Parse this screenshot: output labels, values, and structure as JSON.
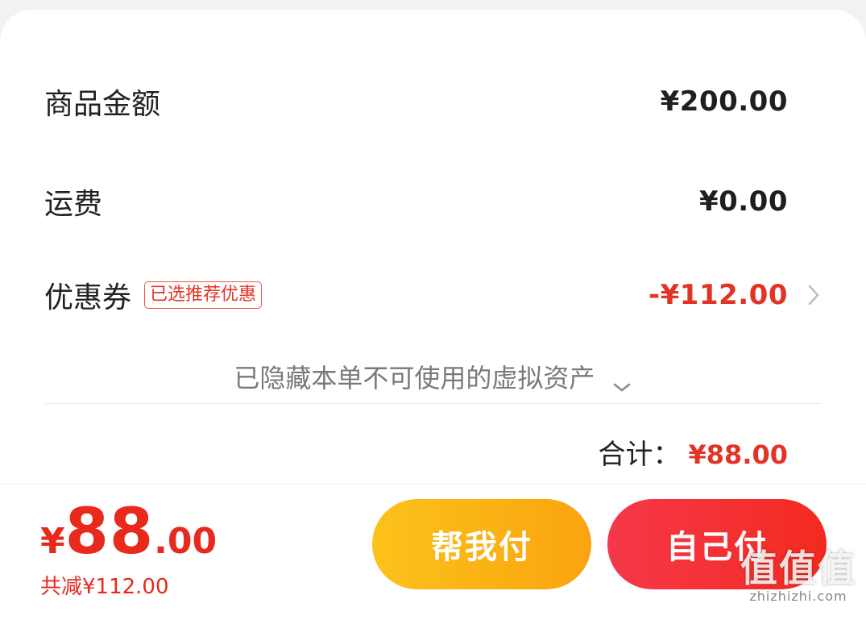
{
  "summary": {
    "goods": {
      "label": "商品金额",
      "amount": "¥200.00"
    },
    "shipping": {
      "label": "运费",
      "amount": "¥0.00"
    },
    "coupon": {
      "label": "优惠券",
      "tag": "已选推荐优惠",
      "amount": "-¥112.00"
    },
    "hidden_assets": "已隐藏本单不可使用的虚拟资产",
    "total": {
      "label": "合计：",
      "amount": "¥88.00"
    }
  },
  "footer": {
    "price_symbol": "¥",
    "price_integer": "88",
    "price_decimal": ".00",
    "saved": "共减¥112.00",
    "help_pay_label": "帮我付",
    "self_pay_label": "自己付"
  },
  "watermark": {
    "big": "值值值",
    "small": "zhizhizhi.com"
  },
  "colors": {
    "accent_red": "#e23325",
    "help_btn": "#fcc21a",
    "self_btn": "#f5384a"
  }
}
